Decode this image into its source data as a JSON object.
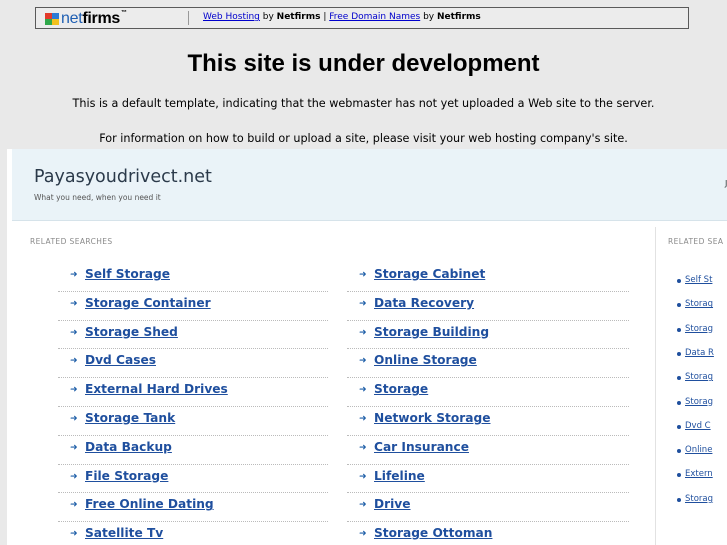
{
  "banner": {
    "logo_net": "net",
    "logo_firms": "firms",
    "logo_tm": "™",
    "link1": "Web Hosting",
    "by1": " by ",
    "brand1": "Netfirms",
    "pipe": " | ",
    "link2": "Free Domain Names",
    "by2": " by ",
    "brand2": "Netfirms"
  },
  "notice": {
    "title": "This site is under development",
    "line1": "This is a default template, indicating that the webmaster has not yet uploaded a Web site to the server.",
    "line2": "For information on how to build or upload a site, please visit your web hosting company's site."
  },
  "parked": {
    "site_name": "Payasyoudrivect.net",
    "tagline": "What you need, when you need it",
    "header_right": "J",
    "related_label": "RELATED SEARCHES",
    "related_label_right": "RELATED SEA",
    "left_col": [
      "Self Storage",
      "Storage Container",
      "Storage Shed",
      "Dvd Cases",
      "External Hard Drives",
      "Storage Tank",
      "Data Backup",
      "File Storage",
      "Free Online Dating",
      "Satellite Tv"
    ],
    "right_col": [
      "Storage Cabinet",
      "Data Recovery",
      "Storage Building",
      "Online Storage",
      "Storage",
      "Network Storage",
      "Car Insurance",
      "Lifeline",
      "Drive",
      "Storage Ottoman"
    ],
    "side_items": [
      "Self St",
      "Storag",
      "Storag",
      "Data R",
      "Storag",
      "Storag",
      "Dvd C",
      "Online",
      "Extern",
      "Storag"
    ]
  }
}
